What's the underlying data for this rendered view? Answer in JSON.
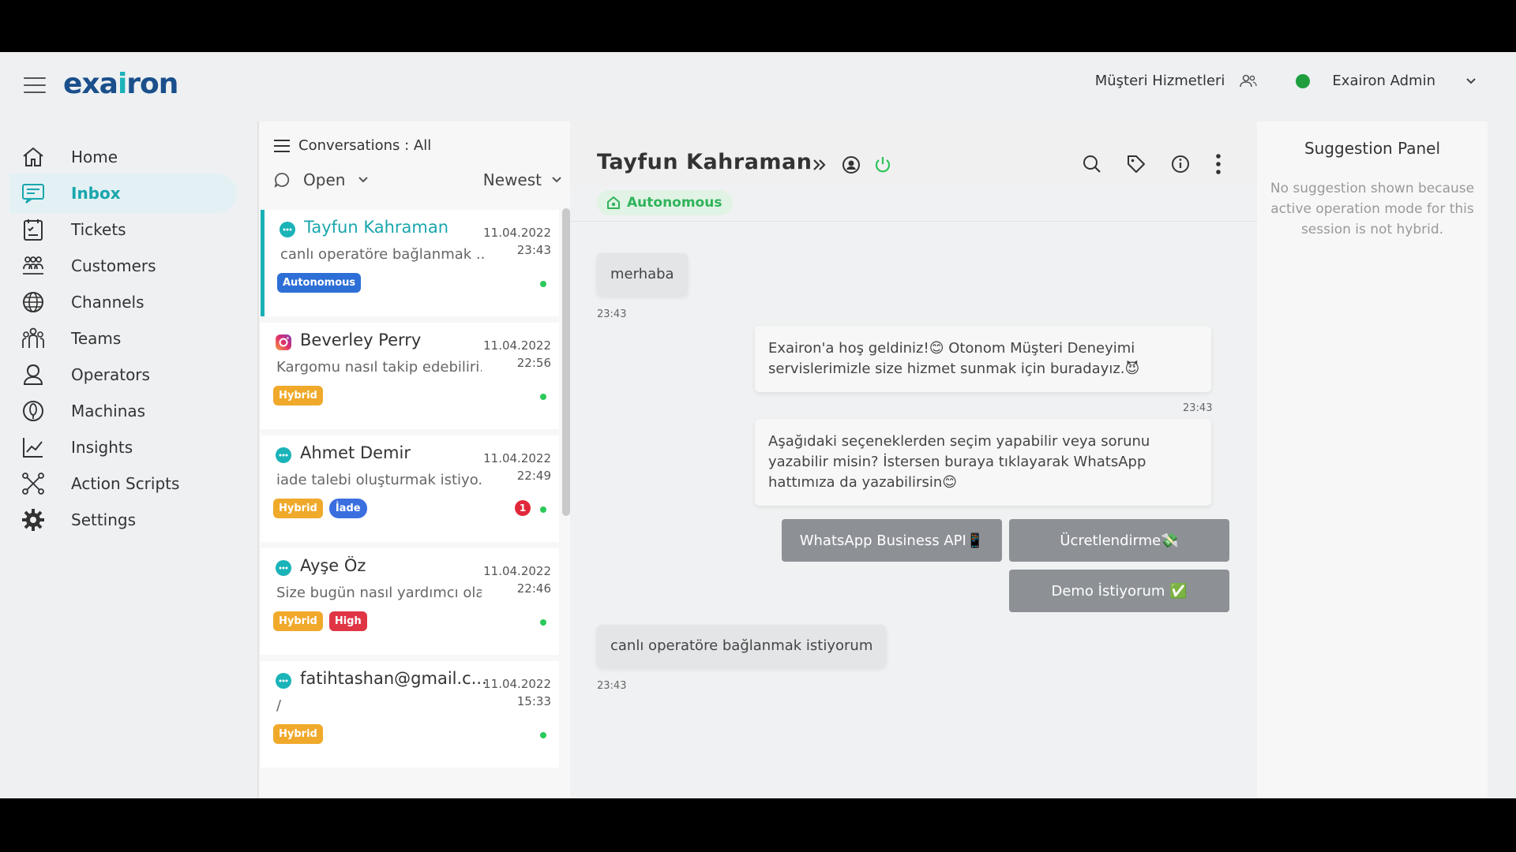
{
  "brand": {
    "logo_main": "exa",
    "logo_accent": "i",
    "logo_tail": "ron"
  },
  "header": {
    "team_name": "Müşteri Hizmetleri",
    "user_name": "Exairon Admin"
  },
  "sidebar": {
    "items": [
      {
        "label": "Home",
        "icon": "home-icon"
      },
      {
        "label": "Inbox",
        "icon": "inbox-icon",
        "active": true
      },
      {
        "label": "Tickets",
        "icon": "tickets-icon"
      },
      {
        "label": "Customers",
        "icon": "customers-icon"
      },
      {
        "label": "Channels",
        "icon": "globe-icon"
      },
      {
        "label": "Teams",
        "icon": "teams-icon"
      },
      {
        "label": "Operators",
        "icon": "operator-icon"
      },
      {
        "label": "Machinas",
        "icon": "robot-icon"
      },
      {
        "label": "Insights",
        "icon": "chart-icon"
      },
      {
        "label": "Action Scripts",
        "icon": "scripts-icon"
      },
      {
        "label": "Settings",
        "icon": "gear-icon"
      }
    ]
  },
  "conversations": {
    "header": "Conversations : All",
    "status_filter": "Open",
    "sort": "Newest",
    "items": [
      {
        "name": "Tayfun Kahraman",
        "date": "11.04.2022",
        "time": "23:43",
        "preview": "canlı operatöre bağlanmak ...",
        "tags": [
          "Autonomous"
        ],
        "channel": "webchat-icon"
      },
      {
        "name": "Beverley Perry",
        "date": "11.04.2022",
        "time": "22:56",
        "preview": "Kargomu nasıl takip edebiliri..",
        "tags": [
          "Hybrid"
        ],
        "channel": "instagram-icon"
      },
      {
        "name": "Ahmet Demir",
        "date": "11.04.2022",
        "time": "22:49",
        "preview": "iade talebi oluşturmak istiyo...",
        "tags": [
          "Hybrid",
          "İade"
        ],
        "unread": "1",
        "channel": "webchat-icon"
      },
      {
        "name": "Ayşe Öz",
        "date": "11.04.2022",
        "time": "22:46",
        "preview": "Size bugün nasıl yardımcı ola",
        "tags": [
          "Hybrid",
          "High"
        ],
        "channel": "webchat-icon"
      },
      {
        "name": "fatihtashan@gmail.c...",
        "date": "11.04.2022",
        "time": "15:33",
        "preview": "/",
        "tags": [
          "Hybrid"
        ],
        "channel": "webchat-icon"
      }
    ]
  },
  "chat": {
    "title": "Tayfun Kahraman",
    "mode": "Autonomous",
    "messages": {
      "m1": {
        "text": "merhaba",
        "time": "23:43"
      },
      "m2": {
        "text": "Exairon'a hoş geldiniz!😊 Otonom Müşteri Deneyimi servislerimizle size hizmet sunmak için buradayız.😈",
        "time": "23:43"
      },
      "m3": {
        "text": "Aşağıdaki seçeneklerden seçim yapabilir veya sorunu yazabilir misin? İstersen buraya tıklayarak WhatsApp hattımıza da yazabilirsin😊"
      },
      "m4": {
        "text": "canlı operatöre bağlanmak istiyorum",
        "time": "23:43"
      }
    },
    "quick_replies": {
      "whatsapp": "WhatsApp Business API📱",
      "pricing": "Ücretlendirme💸",
      "demo": "Demo İstiyorum ✅"
    }
  },
  "suggestion_panel": {
    "title": "Suggestion Panel",
    "text": "No suggestion shown because active operation mode for this session is not hybrid."
  },
  "colors": {
    "accent": "#19a6ad",
    "brand": "#1a4f8b",
    "online": "#1e9e3e",
    "hybrid": "#f0a92a",
    "high": "#e03545",
    "autonomous": "#2d6fd6"
  }
}
